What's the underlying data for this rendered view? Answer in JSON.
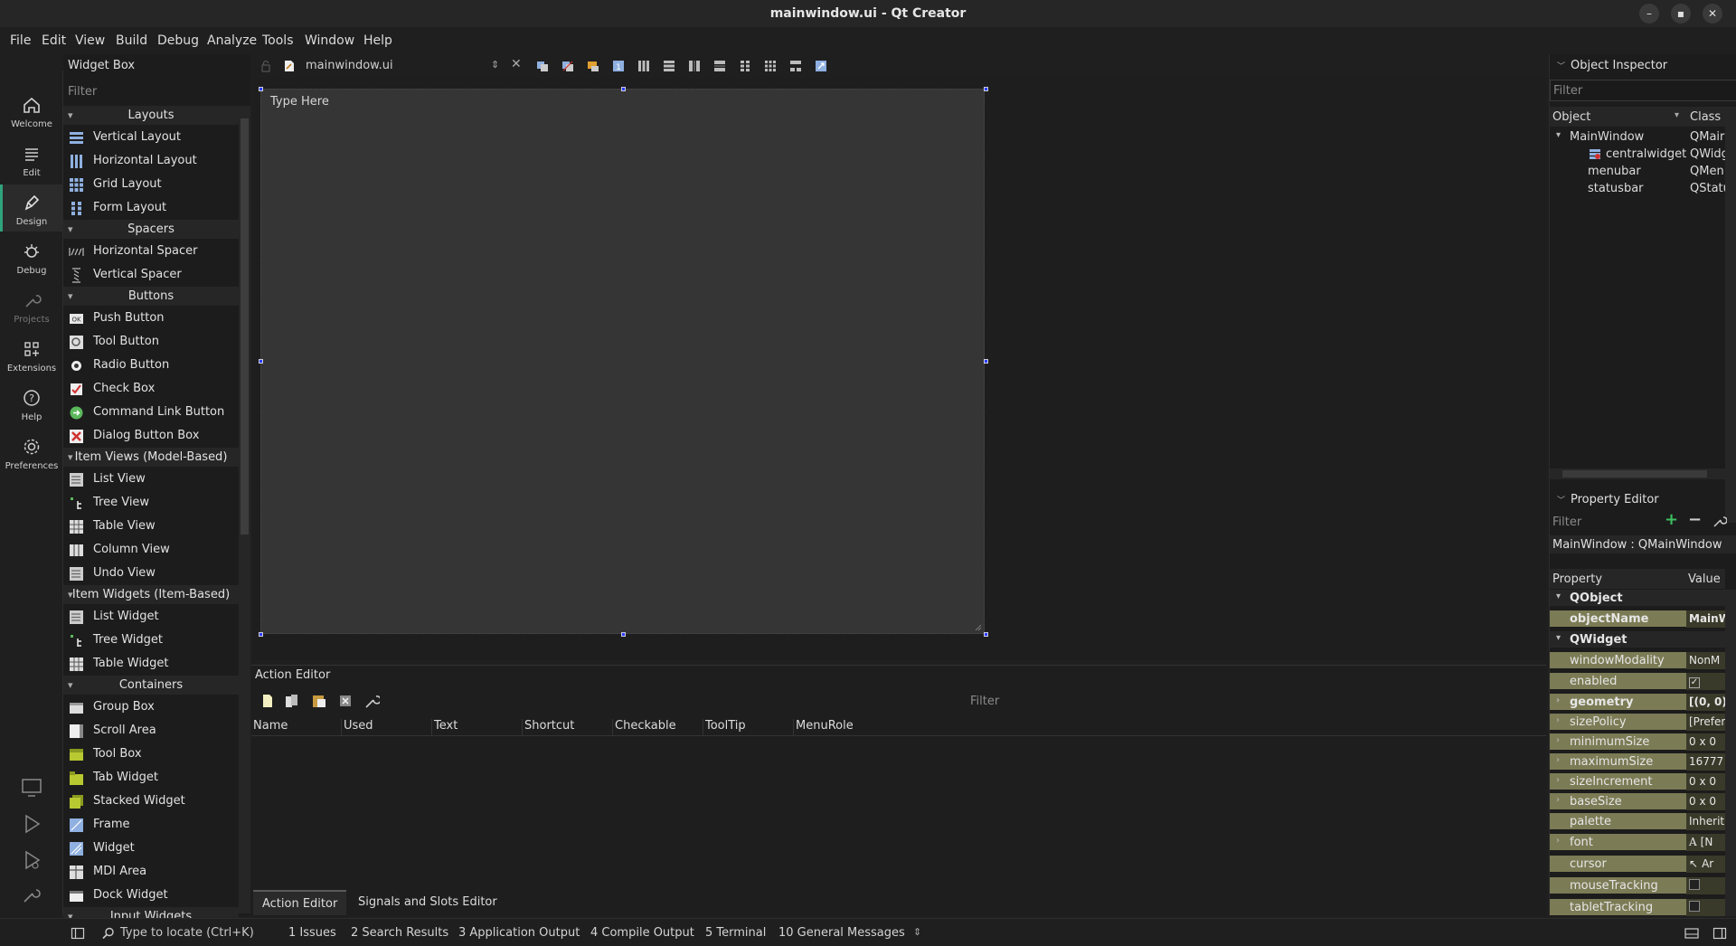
{
  "window": {
    "title": "mainwindow.ui - Qt Creator"
  },
  "menu": [
    "File",
    "Edit",
    "View",
    "Build",
    "Debug",
    "Analyze",
    "Tools",
    "Window",
    "Help"
  ],
  "modes": {
    "welcome": "Welcome",
    "edit": "Edit",
    "design": "Design",
    "debug": "Debug",
    "projects": "Projects",
    "extensions": "Extensions",
    "help": "Help",
    "preferences": "Preferences"
  },
  "widget_box": {
    "title": "Widget Box",
    "filter_placeholder": "Filter",
    "categories": {
      "layouts": "Layouts",
      "spacers": "Spacers",
      "buttons": "Buttons",
      "item_views": "Item Views (Model-Based)",
      "item_widgets": "Item Widgets (Item-Based)",
      "containers": "Containers",
      "input_widgets": "Input Widgets"
    },
    "items": {
      "vertical_layout": "Vertical Layout",
      "horizontal_layout": "Horizontal Layout",
      "grid_layout": "Grid Layout",
      "form_layout": "Form Layout",
      "horizontal_spacer": "Horizontal Spacer",
      "vertical_spacer": "Vertical Spacer",
      "push_button": "Push Button",
      "tool_button": "Tool Button",
      "radio_button": "Radio Button",
      "check_box": "Check Box",
      "command_link_button": "Command Link Button",
      "dialog_button_box": "Dialog Button Box",
      "list_view": "List View",
      "tree_view": "Tree View",
      "table_view": "Table View",
      "column_view": "Column View",
      "undo_view": "Undo View",
      "list_widget": "List Widget",
      "tree_widget": "Tree Widget",
      "table_widget": "Table Widget",
      "group_box": "Group Box",
      "scroll_area": "Scroll Area",
      "tool_box": "Tool Box",
      "tab_widget": "Tab Widget",
      "stacked_widget": "Stacked Widget",
      "frame": "Frame",
      "widget": "Widget",
      "mdi_area": "MDI Area",
      "dock_widget": "Dock Widget"
    }
  },
  "document": {
    "filename": "mainwindow.ui",
    "type_here": "Type Here"
  },
  "action_editor": {
    "title": "Action Editor",
    "filter_placeholder": "Filter",
    "columns": {
      "name": "Name",
      "used": "Used",
      "text": "Text",
      "shortcut": "Shortcut",
      "checkable": "Checkable",
      "tooltip": "ToolTip",
      "menurole": "MenuRole"
    },
    "tabs": {
      "action_editor": "Action Editor",
      "signals_slots": "Signals and Slots Editor"
    }
  },
  "object_inspector": {
    "title": "Object Inspector",
    "filter_placeholder": "Filter",
    "col_object": "Object",
    "col_class": "Class",
    "rows": {
      "mainwindow": {
        "object": "MainWindow",
        "class": "QMair"
      },
      "centralwidget": {
        "object": "centralwidget",
        "class": "QWidg"
      },
      "menubar": {
        "object": "menubar",
        "class": "QMen"
      },
      "statusbar": {
        "object": "statusbar",
        "class": "QStatu"
      }
    }
  },
  "property_editor": {
    "title": "Property Editor",
    "filter_placeholder": "Filter",
    "context": "MainWindow : QMainWindow",
    "col_property": "Property",
    "col_value": "Value",
    "groups": {
      "qobject": "QObject",
      "qwidget": "QWidget"
    },
    "props": {
      "objectName": {
        "name": "objectName",
        "value": "MainW"
      },
      "windowModality": {
        "name": "windowModality",
        "value": "NonM"
      },
      "enabled": {
        "name": "enabled",
        "value": ""
      },
      "geometry": {
        "name": "geometry",
        "value": "[(0, 0),"
      },
      "sizePolicy": {
        "name": "sizePolicy",
        "value": "[Prefer"
      },
      "minimumSize": {
        "name": "minimumSize",
        "value": "0 x 0"
      },
      "maximumSize": {
        "name": "maximumSize",
        "value": "16777"
      },
      "sizeIncrement": {
        "name": "sizeIncrement",
        "value": "0 x 0"
      },
      "baseSize": {
        "name": "baseSize",
        "value": "0 x 0"
      },
      "palette": {
        "name": "palette",
        "value": "Inherit"
      },
      "font": {
        "name": "font",
        "value": "[N"
      },
      "cursor": {
        "name": "cursor",
        "value": "Ar"
      },
      "mouseTracking": {
        "name": "mouseTracking",
        "value": ""
      },
      "tabletTracking": {
        "name": "tabletTracking",
        "value": ""
      }
    }
  },
  "status_bar": {
    "locate_placeholder": "Type to locate (Ctrl+K)",
    "panes": {
      "issues": "1  Issues",
      "search": "2  Search Results",
      "app_output": "3  Application Output",
      "compile": "4  Compile Output",
      "terminal": "5  Terminal",
      "general": "10  General Messages"
    }
  },
  "colors": {
    "accent": "#2fa37c",
    "handle": "#2a3dff",
    "object_row": "#7b7b55"
  }
}
